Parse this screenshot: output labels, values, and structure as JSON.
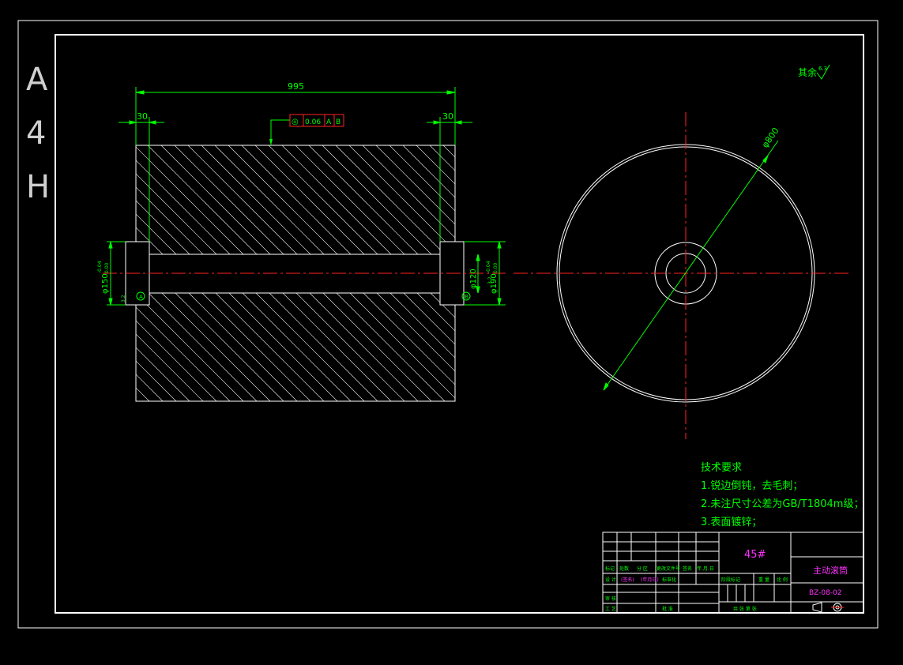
{
  "sheet": {
    "format_label": [
      "A",
      "4",
      "H"
    ],
    "roughness_note": {
      "text": "其余",
      "value": "6.3"
    }
  },
  "colors": {
    "background": "#000000",
    "outline": "#ffffff",
    "dimension": "#00ff00",
    "centerline": "#ff2222",
    "title_text": "#ff33ff"
  },
  "front_view": {
    "overall_length": "995",
    "left_shaft_length": "30",
    "right_shaft_length": "30",
    "bore_diameter": "φ120",
    "left_shaft_diameter": "φ150",
    "left_shaft_tolerance": {
      "upper": "-0.04",
      "lower": "0.00"
    },
    "right_shaft_diameter": "φ190",
    "right_shaft_tolerance": {
      "upper": "-0.04",
      "lower": "0.00"
    },
    "left_datum": "A",
    "right_datum": "B",
    "runout_frame": {
      "symbol": "◎",
      "value": "0.06",
      "datums": [
        "A",
        "B"
      ]
    },
    "roughness_left": "3.2",
    "roughness_right": "3.2"
  },
  "side_view": {
    "outer_diameter": "φ800"
  },
  "tech_requirements": {
    "title": "技术要求",
    "items": [
      "1.锐边倒钝，去毛刺；",
      "2.未注尺寸公差为GB/T1804m级；",
      "3.表面镀锌；"
    ]
  },
  "title_block": {
    "material": "45#",
    "part_name": "主动滚筒",
    "drawing_number": "BZ-08-02",
    "header_row": [
      "标记",
      "处数",
      "分 区",
      "更改文件号",
      "签名",
      "年.月.日"
    ],
    "design_row": [
      "设 计",
      "(签名)",
      "(年月日)",
      "标准化"
    ],
    "stage_labels": [
      "阶段标记",
      "重 量",
      "比 例"
    ],
    "review_label": "审 核",
    "process_label": "工 艺",
    "approve_label": "批 准",
    "sheet_label": "共  张  第  张"
  }
}
